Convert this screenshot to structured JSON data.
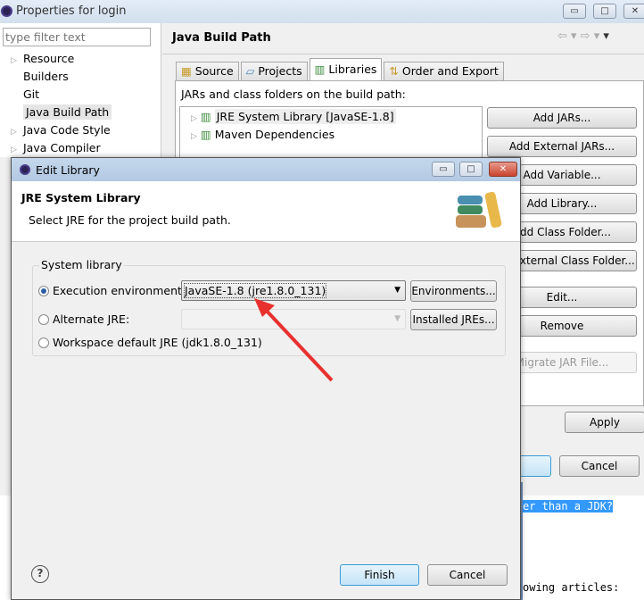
{
  "window": {
    "title": "Properties for login"
  },
  "sidebar": {
    "filter_placeholder": "type filter text",
    "items": [
      {
        "label": "Resource",
        "expandable": true
      },
      {
        "label": "Builders",
        "expandable": false
      },
      {
        "label": "Git",
        "expandable": false
      },
      {
        "label": "Java Build Path",
        "expandable": false,
        "selected": true
      },
      {
        "label": "Java Code Style",
        "expandable": true
      },
      {
        "label": "Java Compiler",
        "expandable": true
      }
    ]
  },
  "main": {
    "title": "Java Build Path",
    "tabs": [
      {
        "label": "Source"
      },
      {
        "label": "Projects"
      },
      {
        "label": "Libraries",
        "active": true
      },
      {
        "label": "Order and Export"
      }
    ],
    "list_label": "JARs and class folders on the build path:",
    "entries": [
      {
        "label": "JRE System Library [JavaSE-1.8]"
      },
      {
        "label": "Maven Dependencies"
      }
    ],
    "buttons": [
      "Add JARs...",
      "Add External JARs...",
      "Add Variable...",
      "Add Library...",
      "Add Class Folder...",
      "Add External Class Folder...",
      "Edit...",
      "Remove",
      "Migrate JAR File..."
    ],
    "apply": "Apply",
    "cancel": "Cancel"
  },
  "editor": {
    "line1": "er than a JDK?",
    "line2": "owing articles:"
  },
  "dialog": {
    "title": "Edit Library",
    "heading": "JRE System Library",
    "description": "Select JRE for the project build path.",
    "group_label": "System library",
    "options": [
      {
        "label": "Execution environment:",
        "selected": true,
        "value": "JavaSE-1.8 (jre1.8.0_131)",
        "button": "Environments..."
      },
      {
        "label": "Alternate JRE:",
        "selected": false,
        "value": "",
        "button": "Installed JREs..."
      },
      {
        "label": "Workspace default JRE (jdk1.8.0_131)",
        "selected": false
      }
    ],
    "finish": "Finish",
    "cancel": "Cancel"
  },
  "colors": {
    "accent": "#3399ff",
    "arrow": "#e8312f"
  }
}
